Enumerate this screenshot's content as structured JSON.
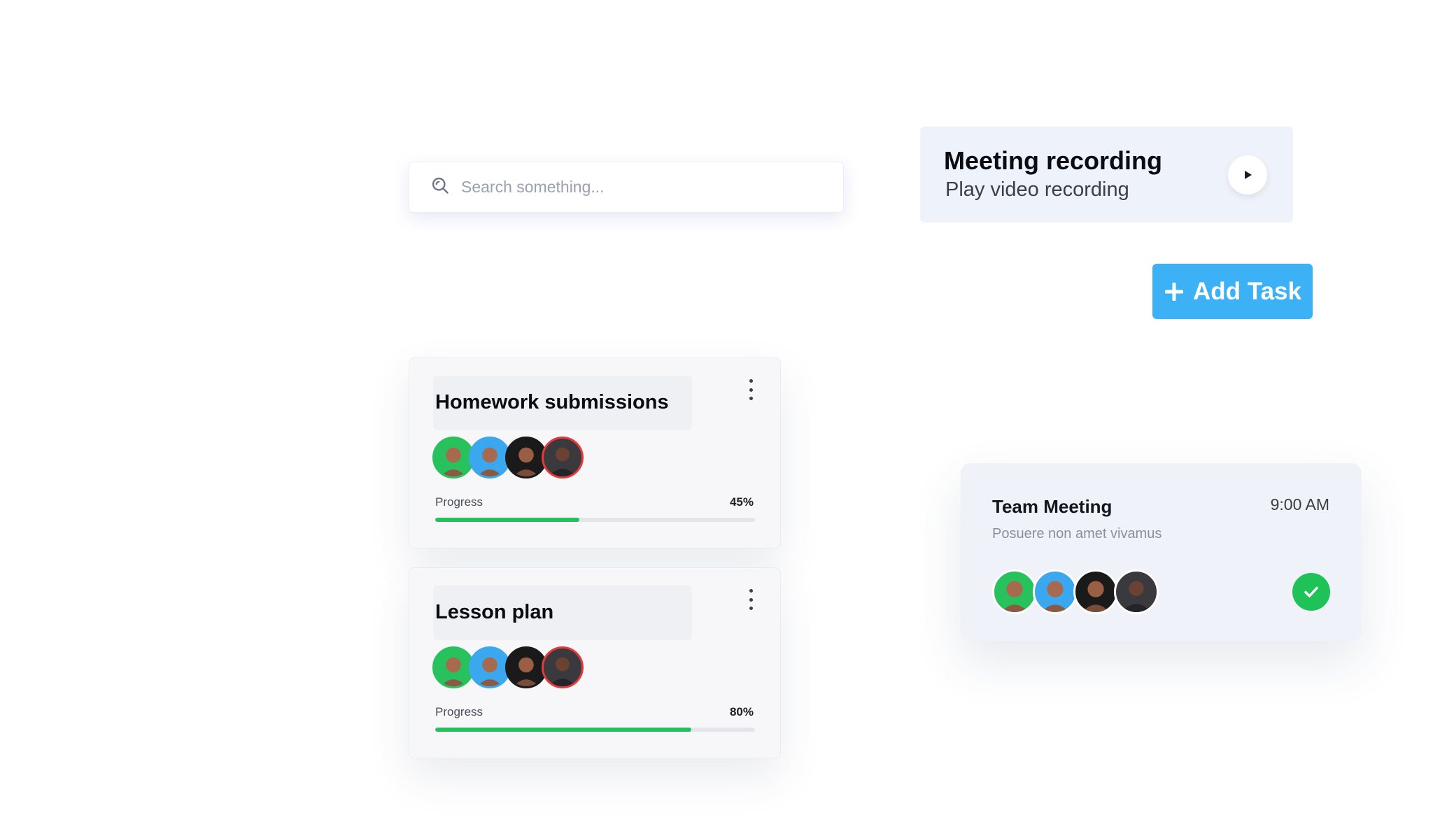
{
  "search": {
    "placeholder": "Search something...",
    "icon": "search-icon"
  },
  "recording": {
    "title": "Meeting recording",
    "subtitle": "Play video recording",
    "icon": "play-icon"
  },
  "add_task": {
    "label": "Add Task",
    "icon": "plus-icon",
    "color": "#3db1f6"
  },
  "tasks": [
    {
      "title": "Homework submissions",
      "progress_label": "Progress",
      "progress_text": "45%",
      "progress": 0.45
    },
    {
      "title": "Lesson plan",
      "progress_label": "Progress",
      "progress_text": "80%",
      "progress": 0.8
    }
  ],
  "avatar_ring_colors": [
    "#27c25e",
    "#3aa7ef",
    "#1a1a1a",
    "#e23b3b"
  ],
  "progress_color": "#25c05d",
  "meeting": {
    "title": "Team Meeting",
    "time": "9:00 AM",
    "description": "Posuere non amet vivamus",
    "status_icon": "check-icon",
    "status_color": "#1ec257"
  }
}
